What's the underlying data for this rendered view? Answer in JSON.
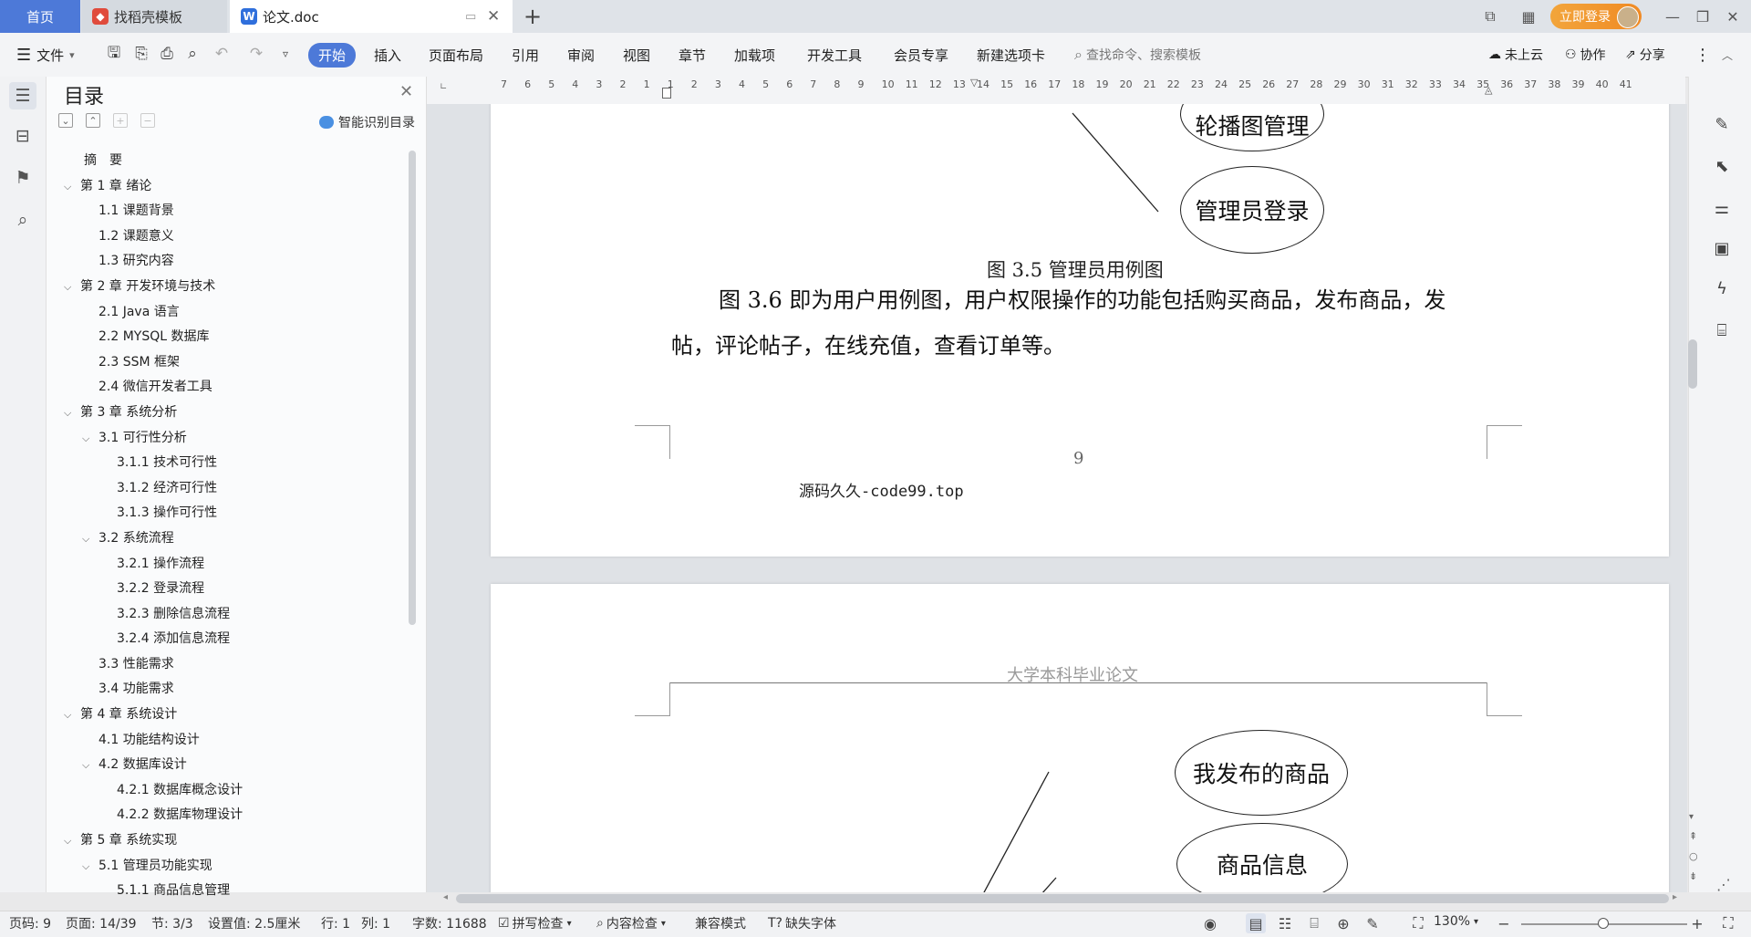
{
  "tabs": {
    "home": "首页",
    "template": "找稻壳模板",
    "document": "论文.doc"
  },
  "titlebar": {
    "login": "立即登录"
  },
  "menu": {
    "file": "文件",
    "items": [
      "开始",
      "插入",
      "页面布局",
      "引用",
      "审阅",
      "视图",
      "章节",
      "加载项",
      "开发工具",
      "会员专享",
      "新建选项卡"
    ],
    "search_placeholder": "查找命令、搜索模板",
    "cloud": "未上云",
    "collab": "协作",
    "share": "分享"
  },
  "toc": {
    "title": "目录",
    "smart": "智能识别目录",
    "items": [
      {
        "text": "摘　要",
        "level": 0,
        "chev": ""
      },
      {
        "text": "第 1 章  绪论",
        "level": 0,
        "chev": "v"
      },
      {
        "text": "1.1  课题背景",
        "level": 1,
        "chev": ""
      },
      {
        "text": "1.2  课题意义",
        "level": 1,
        "chev": ""
      },
      {
        "text": "1.3  研究内容",
        "level": 1,
        "chev": ""
      },
      {
        "text": "第 2 章  开发环境与技术",
        "level": 0,
        "chev": "v"
      },
      {
        "text": "2.1 Java 语言",
        "level": 1,
        "chev": ""
      },
      {
        "text": "2.2 MYSQL 数据库",
        "level": 1,
        "chev": ""
      },
      {
        "text": "2.3 SSM 框架",
        "level": 1,
        "chev": ""
      },
      {
        "text": "2.4 微信开发者工具",
        "level": 1,
        "chev": ""
      },
      {
        "text": "第 3 章  系统分析",
        "level": 0,
        "chev": "v"
      },
      {
        "text": "3.1  可行性分析",
        "level": 1,
        "chev": "v"
      },
      {
        "text": "3.1.1  技术可行性",
        "level": 2,
        "chev": ""
      },
      {
        "text": "3.1.2  经济可行性",
        "level": 2,
        "chev": ""
      },
      {
        "text": "3.1.3  操作可行性",
        "level": 2,
        "chev": ""
      },
      {
        "text": "3.2  系统流程",
        "level": 1,
        "chev": "v"
      },
      {
        "text": "3.2.1  操作流程",
        "level": 2,
        "chev": ""
      },
      {
        "text": "3.2.2  登录流程",
        "level": 2,
        "chev": ""
      },
      {
        "text": "3.2.3  删除信息流程",
        "level": 2,
        "chev": ""
      },
      {
        "text": "3.2.4  添加信息流程",
        "level": 2,
        "chev": ""
      },
      {
        "text": "3.3  性能需求",
        "level": 1,
        "chev": ""
      },
      {
        "text": "3.4  功能需求",
        "level": 1,
        "chev": ""
      },
      {
        "text": "第 4 章  系统设计",
        "level": 0,
        "chev": "v"
      },
      {
        "text": "4.1  功能结构设计",
        "level": 1,
        "chev": ""
      },
      {
        "text": "4.2  数据库设计",
        "level": 1,
        "chev": "v"
      },
      {
        "text": "4.2.1  数据库概念设计",
        "level": 2,
        "chev": ""
      },
      {
        "text": "4.2.2  数据库物理设计",
        "level": 2,
        "chev": ""
      },
      {
        "text": "第 5 章  系统实现",
        "level": 0,
        "chev": "v"
      },
      {
        "text": "5.1  管理员功能实现",
        "level": 1,
        "chev": "v"
      },
      {
        "text": "5.1.1  商品信息管理",
        "level": 2,
        "chev": ""
      }
    ]
  },
  "ruler": [
    "7",
    "6",
    "5",
    "4",
    "3",
    "2",
    "1",
    "1",
    "2",
    "3",
    "4",
    "5",
    "6",
    "7",
    "8",
    "9",
    "10",
    "11",
    "12",
    "13",
    "14",
    "15",
    "16",
    "17",
    "18",
    "19",
    "20",
    "21",
    "22",
    "23",
    "24",
    "25",
    "26",
    "27",
    "28",
    "29",
    "30",
    "31",
    "32",
    "33",
    "34",
    "35",
    "36",
    "37",
    "38",
    "39",
    "40",
    "41"
  ],
  "doc": {
    "page1": {
      "ellipse_top": "轮播图管理",
      "ellipse_admin": "管理员登录",
      "caption": "图 3.5  管理员用例图",
      "para_line1": "图 3.6 即为用户用例图，用户权限操作的功能包括购买商品，发布商品，发",
      "para_line2": "帖，评论帖子，在线充值，查看订单等。",
      "page_number": "9",
      "watermark": "源码久久-code99.top"
    },
    "page2": {
      "header": "大学本科毕业论文",
      "ellipse1": "我发布的商品",
      "ellipse2": "商品信息"
    }
  },
  "status": {
    "page": "页码: 9",
    "pages": "页面: 14/39",
    "section": "节: 3/3",
    "setting": "设置值: 2.5厘米",
    "row": "行: 1",
    "col": "列: 1",
    "words": "字数: 11688",
    "spell": "拼写检查",
    "content": "内容检查",
    "compat": "兼容模式",
    "font_missing": "缺失字体",
    "zoom": "130%"
  }
}
